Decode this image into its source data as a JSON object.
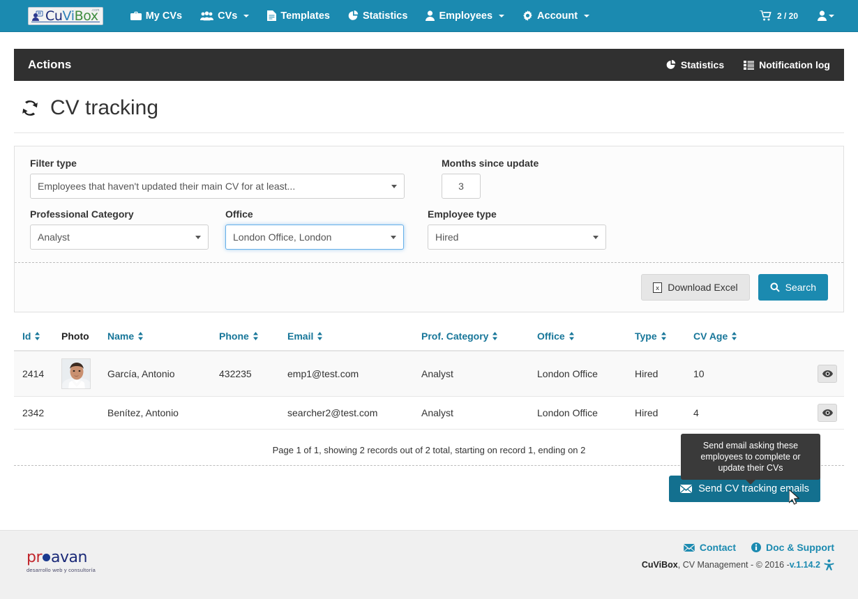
{
  "navbar": {
    "brand": {
      "part1": "Cu",
      "part2": "Vi",
      "part3": "Box",
      "tld": ".com"
    },
    "items": [
      {
        "label": "My CVs",
        "icon": "briefcase-icon",
        "caret": false
      },
      {
        "label": "CVs",
        "icon": "users-icon",
        "caret": true
      },
      {
        "label": "Templates",
        "icon": "file-text-icon",
        "caret": false
      },
      {
        "label": "Statistics",
        "icon": "pie-chart-icon",
        "caret": false
      },
      {
        "label": "Employees",
        "icon": "user-icon",
        "caret": true
      },
      {
        "label": "Account",
        "icon": "gear-icon",
        "caret": true
      }
    ],
    "cart_count": "2 / 20",
    "cart_icon": "shopping-cart-icon",
    "user_icon": "user-icon"
  },
  "actions_bar": {
    "title": "Actions",
    "links": [
      {
        "label": "Statistics",
        "icon": "pie-chart-icon"
      },
      {
        "label": "Notification log",
        "icon": "list-icon"
      }
    ]
  },
  "page": {
    "title": "CV tracking",
    "title_icon": "refresh-icon"
  },
  "filters": {
    "filter_type": {
      "label": "Filter type",
      "value": "Employees that haven't updated their main CV for at least...",
      "focused": false
    },
    "months_since_update": {
      "label": "Months since update",
      "value": "3",
      "placeholder": ""
    },
    "professional_category": {
      "label": "Professional Category",
      "value": "Analyst",
      "focused": false
    },
    "office": {
      "label": "Office",
      "value": "London Office, London",
      "focused": true
    },
    "employee_type": {
      "label": "Employee type",
      "value": "Hired",
      "focused": false
    },
    "buttons": {
      "download_excel": {
        "label": "Download Excel",
        "icon": "excel-file-icon"
      },
      "search": {
        "label": "Search",
        "icon": "search-icon"
      }
    }
  },
  "table": {
    "columns": [
      {
        "label": "Id",
        "sortable": true
      },
      {
        "label": "Photo",
        "sortable": false
      },
      {
        "label": "Name",
        "sortable": true
      },
      {
        "label": "Phone",
        "sortable": true
      },
      {
        "label": "Email",
        "sortable": true
      },
      {
        "label": "Prof. Category",
        "sortable": true
      },
      {
        "label": "Office",
        "sortable": true
      },
      {
        "label": "Type",
        "sortable": true
      },
      {
        "label": "CV Age",
        "sortable": true
      }
    ],
    "rows": [
      {
        "id": "2414",
        "photo": "employee-photo",
        "name": "García, Antonio",
        "phone": "432235",
        "email": "emp1@test.com",
        "category": "Analyst",
        "office": "London Office",
        "type": "Hired",
        "cv_age": "10",
        "action_icon": "eye-icon"
      },
      {
        "id": "2342",
        "photo": "",
        "name": "Benítez, Antonio",
        "phone": "",
        "email": "searcher2@test.com",
        "category": "Analyst",
        "office": "London Office",
        "type": "Hired",
        "cv_age": "4",
        "action_icon": "eye-icon"
      }
    ],
    "pager_text": "Page 1 of 1, showing 2 records out of 2 total, starting on record 1, ending on 2"
  },
  "send_action": {
    "tooltip": "Send email asking these employees to complete or update their CVs",
    "button_label": "Send CV tracking emails",
    "button_icon": "envelope-icon"
  },
  "footer": {
    "partner": {
      "part1": "pr",
      "part2": "avan",
      "tagline": "desarrollo web y consultoría"
    },
    "links": [
      {
        "label": "Contact",
        "icon": "envelope-icon"
      },
      {
        "label": "Doc & Support",
        "icon": "info-circle-icon"
      }
    ],
    "copyright_brand": "CuViBox",
    "copyright_text": ", CV Management - © 2016 - ",
    "version": "v.1.14.2",
    "accessibility_icon": "universal-access-icon"
  },
  "colors": {
    "brand_blue": "#1b8ab0",
    "dark_bar": "#303030",
    "link_teal": "#177699",
    "send_button": "#13708f"
  }
}
